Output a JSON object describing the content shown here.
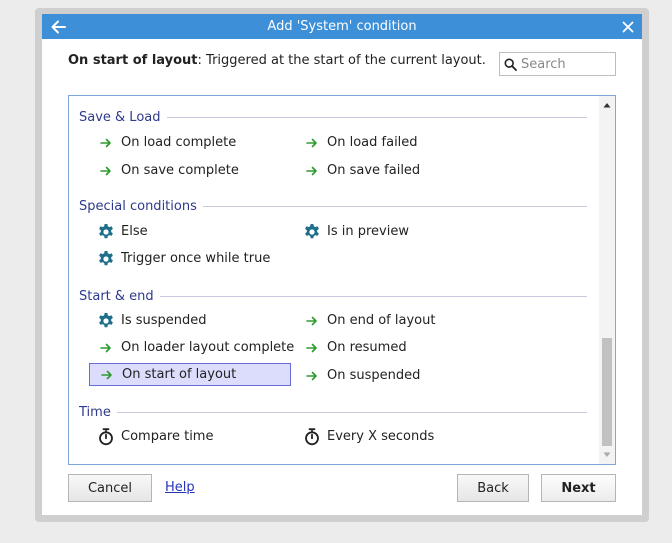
{
  "dialog": {
    "title": "Add 'System' condition",
    "description_bold": "On start of layout",
    "description_rest": ": Triggered at the start of the current layout.",
    "search_placeholder": "Search"
  },
  "sections": [
    {
      "title": "Save & Load",
      "items": [
        {
          "label": "On load complete",
          "icon": "arrow-right-icon"
        },
        {
          "label": "On load failed",
          "icon": "arrow-right-icon"
        },
        {
          "label": "On save complete",
          "icon": "arrow-right-icon"
        },
        {
          "label": "On save failed",
          "icon": "arrow-right-icon"
        }
      ]
    },
    {
      "title": "Special conditions",
      "items": [
        {
          "label": "Else",
          "icon": "gear-icon"
        },
        {
          "label": "Is in preview",
          "icon": "gear-icon"
        },
        {
          "label": "Trigger once while true",
          "icon": "gear-icon"
        }
      ]
    },
    {
      "title": "Start & end",
      "items": [
        {
          "label": "Is suspended",
          "icon": "gear-icon"
        },
        {
          "label": "On end of layout",
          "icon": "arrow-right-icon"
        },
        {
          "label": "On loader layout complete",
          "icon": "arrow-right-icon"
        },
        {
          "label": "On resumed",
          "icon": "arrow-right-icon"
        },
        {
          "label": "On start of layout",
          "icon": "arrow-right-icon",
          "selected": true
        },
        {
          "label": "On suspended",
          "icon": "arrow-right-icon"
        }
      ]
    },
    {
      "title": "Time",
      "items": [
        {
          "label": "Compare time",
          "icon": "stopwatch-icon"
        },
        {
          "label": "Every X seconds",
          "icon": "stopwatch-icon"
        }
      ]
    }
  ],
  "buttons": {
    "cancel": "Cancel",
    "help": "Help",
    "back": "Back",
    "next": "Next"
  },
  "colors": {
    "title_bar": "#3d8fd8",
    "section_header": "#2e3a8c",
    "trigger_arrow": "#2e9a2e",
    "gear": "#1f6f8b",
    "selection_bg": "#dcdcfc",
    "link": "#2633b8"
  }
}
